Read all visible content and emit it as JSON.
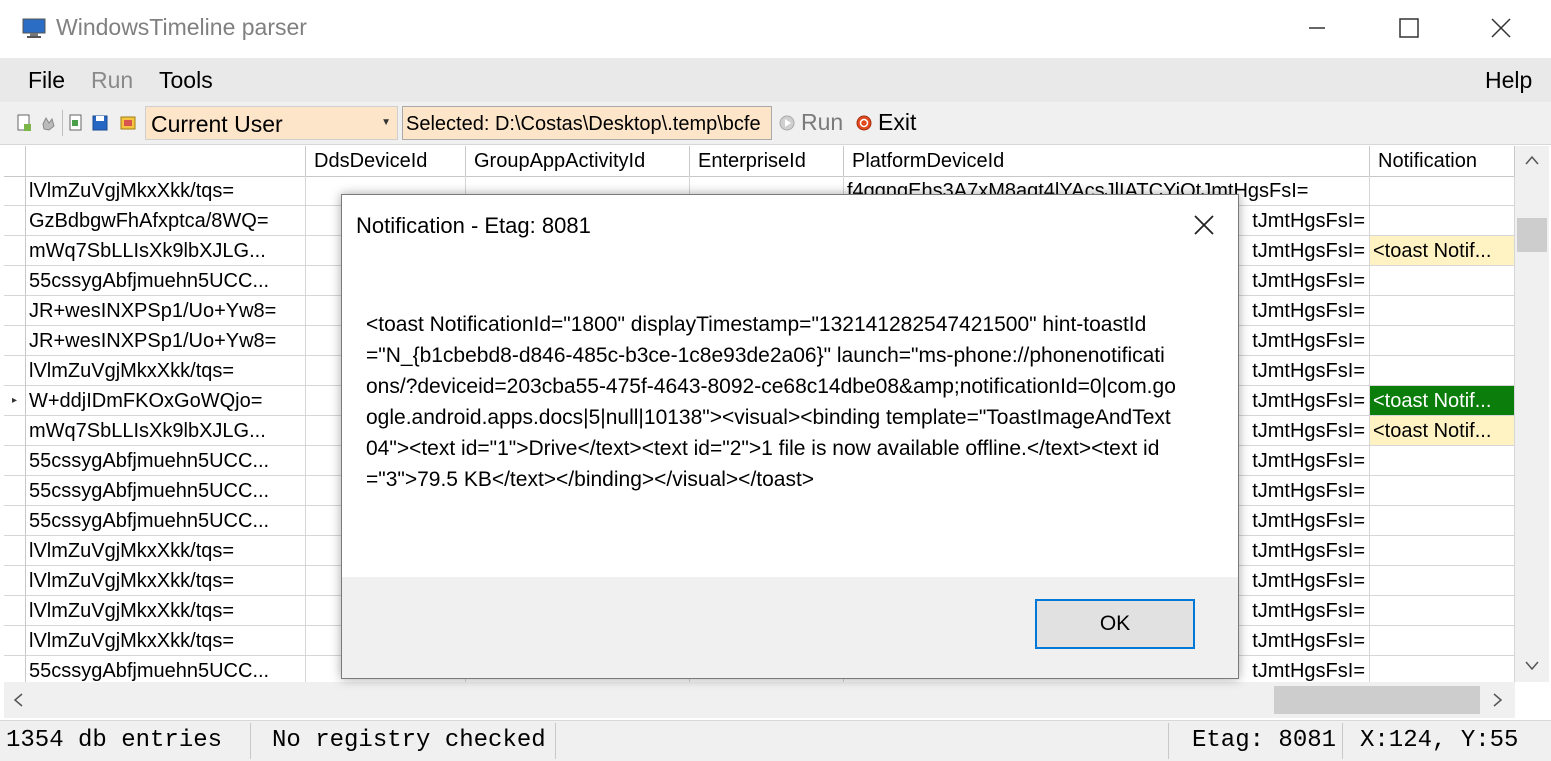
{
  "window": {
    "title": "WindowsTimeline parser"
  },
  "menu": {
    "file": "File",
    "run": "Run",
    "tools": "Tools",
    "help": "Help"
  },
  "toolbar": {
    "user_combo": "Current User",
    "selected_path": "Selected: D:\\Costas\\Desktop\\.temp\\bcfe",
    "run_label": "Run",
    "exit_label": "Exit"
  },
  "grid": {
    "columns": [
      "",
      "DdsDeviceId",
      "GroupAppActivityId",
      "EnterpriseId",
      "PlatformDeviceId",
      "Notification"
    ],
    "rows": [
      {
        "c0": "lVlmZuVgjMkxXkk/tqs=",
        "c4": "f4ggngEhs3A7xM8agt4lYAcsJlIATCYiQtJmtHgsFsI=",
        "c5": ""
      },
      {
        "c0": "GzBdbgwFhAfxptca/8WQ=",
        "c4": "tJmtHgsFsI=",
        "c5": ""
      },
      {
        "c0": "mWq7SbLLIsXk9lbXJLG...",
        "c4": "tJmtHgsFsI=",
        "c5": "<toast Notif..."
      },
      {
        "c0": "55cssygAbfjmuehn5UCC...",
        "c4": "tJmtHgsFsI=",
        "c5": ""
      },
      {
        "c0": "JR+wesINXPSp1/Uo+Yw8=",
        "c4": "tJmtHgsFsI=",
        "c5": ""
      },
      {
        "c0": "JR+wesINXPSp1/Uo+Yw8=",
        "c4": "tJmtHgsFsI=",
        "c5": ""
      },
      {
        "c0": "lVlmZuVgjMkxXkk/tqs=",
        "c4": "tJmtHgsFsI=",
        "c5": ""
      },
      {
        "c0": "W+ddjIDmFKOxGoWQjo=",
        "c4": "tJmtHgsFsI=",
        "c5": "<toast Notif..."
      },
      {
        "c0": "mWq7SbLLIsXk9lbXJLG...",
        "c4": "tJmtHgsFsI=",
        "c5": "<toast Notif..."
      },
      {
        "c0": "55cssygAbfjmuehn5UCC...",
        "c4": "tJmtHgsFsI=",
        "c5": ""
      },
      {
        "c0": "55cssygAbfjmuehn5UCC...",
        "c4": "tJmtHgsFsI=",
        "c5": ""
      },
      {
        "c0": "55cssygAbfjmuehn5UCC...",
        "c4": "tJmtHgsFsI=",
        "c5": ""
      },
      {
        "c0": "lVlmZuVgjMkxXkk/tqs=",
        "c4": "tJmtHgsFsI=",
        "c5": ""
      },
      {
        "c0": "lVlmZuVgjMkxXkk/tqs=",
        "c4": "tJmtHgsFsI=",
        "c5": ""
      },
      {
        "c0": "lVlmZuVgjMkxXkk/tqs=",
        "c4": "tJmtHgsFsI=",
        "c5": ""
      },
      {
        "c0": "lVlmZuVgjMkxXkk/tqs=",
        "c4": "tJmtHgsFsI=",
        "c5": ""
      },
      {
        "c0": "55cssygAbfjmuehn5UCC...",
        "c4": "tJmtHgsFsI=",
        "c5": ""
      }
    ],
    "selected_row": 7,
    "highlight_rows": [
      2,
      8
    ]
  },
  "dialog": {
    "title": "Notification - Etag: 8081",
    "message": "<toast NotificationId=\"1800\" displayTimestamp=\"132141282547421500\" hint-toastId=\"N_{b1cbebd8-d846-485c-b3ce-1c8e93de2a06}\" launch=\"ms-phone://phonenotifications/?deviceid=203cba55-475f-4643-8092-ce68c14dbe08&amp;notificationId=0|com.google.android.apps.docs|5|null|10138\"><visual><binding template=\"ToastImageAndText04\"><text id=\"1\">Drive</text><text id=\"2\">1 file is now available offline.</text><text id=\"3\">79.5 KB</text></binding></visual></toast>",
    "ok_label": "OK"
  },
  "status": {
    "entries": "1354 db entries",
    "registry": "No registry checked",
    "etag": "Etag: 8081",
    "coords": "X:124, Y:55"
  },
  "colors": {
    "selected_bg": "#0a7d0a",
    "highlight_bg": "#fff3c4",
    "combo_bg": "#fde5c9",
    "focus_border": "#0078d7"
  }
}
